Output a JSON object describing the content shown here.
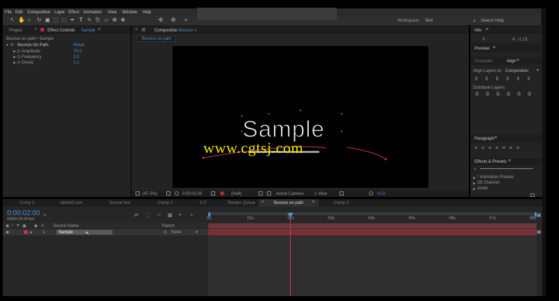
{
  "menu": [
    "File",
    "Edit",
    "Composition",
    "Layer",
    "Effect",
    "Animation",
    "View",
    "Window",
    "Help"
  ],
  "toolbar": {
    "workspace_label": "Workspace:",
    "workspace_value": "Text",
    "search_help": "Search Help"
  },
  "left_panel": {
    "tab_project": "Project",
    "tab_effect_controls": "Effect Controls",
    "tab_effect_target": "Sample",
    "breadcrumb": "Bounce on path • Sample",
    "effect_name": "Bounce On Path",
    "reset_label": "Reset",
    "params": [
      {
        "name": "Amplitude",
        "value": "75.0"
      },
      {
        "name": "Frequency",
        "value": "2.3"
      },
      {
        "name": "Decay",
        "value": "1.1"
      }
    ]
  },
  "composition": {
    "tab_label": "Composition",
    "tab_name": "Bounce o",
    "comp_tab": "Bounce on path",
    "sample_text": "Sample",
    "watermark": "www.cgtsj.com",
    "bottom_bar": {
      "zoom": "(47.5%)",
      "time": "0:00:02:00",
      "resolution": "(Half)",
      "camera": "Active Camera",
      "view": "1 View",
      "exposure": "+0.0"
    }
  },
  "right_panel": {
    "info_tab": "Info",
    "info_x": "X :",
    "info_y": "X :",
    "info_y_val": "-1.15",
    "preview_tab": "Preview",
    "character_tab": "Character",
    "align_tab": "Align",
    "align_layers_to": "Align Layers to:",
    "align_target": "Composition",
    "distribute_layers": "Distribute Layers:",
    "paragraph_tab": "Paragraph",
    "effects_presets_tab": "Effects & Presets",
    "presets": [
      "* Animation Presets",
      "3D Channel",
      "Audio"
    ]
  },
  "timeline": {
    "tabs": [
      {
        "label": "Comp 1",
        "active": false
      },
      {
        "label": "takefell.com",
        "active": false
      },
      {
        "label": "Source text",
        "active": false
      },
      {
        "label": "Comp 2",
        "active": false
      },
      {
        "label": "A 3",
        "active": false
      },
      {
        "label": "Render Queue",
        "active": false
      },
      {
        "label": "Bounce on path",
        "active": true
      },
      {
        "label": "Comp 3",
        "active": false
      }
    ],
    "timecode": "0:00:02:00",
    "frames": "00050 (25.00 fps)",
    "col_source_name": "Source Name",
    "col_parent": "Parent",
    "layer_num": "1",
    "layer_name": "Sample",
    "parent_value": "None",
    "ruler": [
      "0s",
      "01s",
      "02s",
      "03s",
      "04s",
      "05s",
      "06s",
      "07s",
      "08s"
    ]
  },
  "colors": {
    "accent_blue": "#4a90d9",
    "keyframe_red": "#c73a5c",
    "watermark_yellow": "#f2e600",
    "playhead": "#3aa7d8"
  }
}
